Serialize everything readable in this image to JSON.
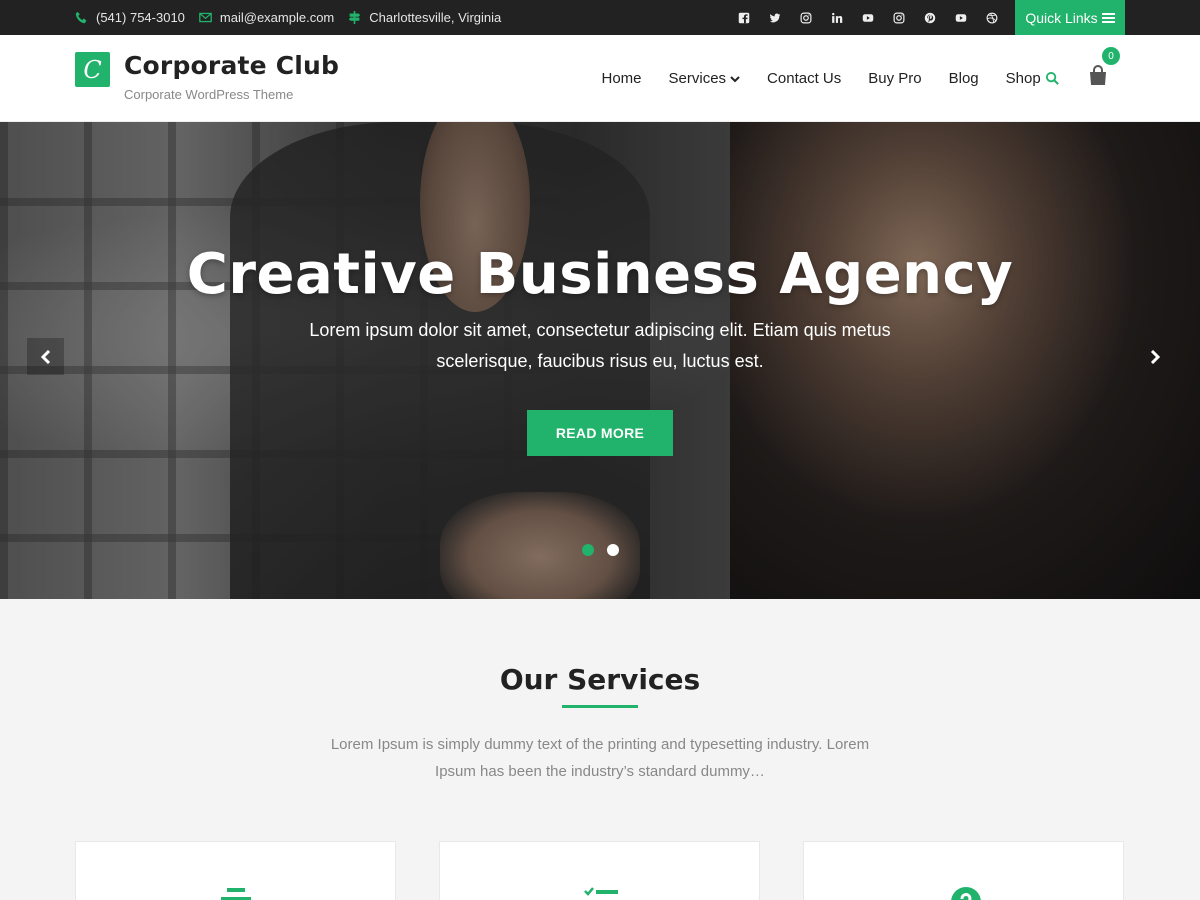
{
  "topbar": {
    "phone": "(541) 754-3010",
    "email": "mail@example.com",
    "location": "Charlottesville, Virginia",
    "social": [
      "facebook-icon",
      "twitter-icon",
      "instagram-icon",
      "linkedin-icon",
      "youtube-icon",
      "instagram-icon",
      "pinterest-icon",
      "youtube-icon",
      "dribbble-icon"
    ],
    "quick_links": "Quick Links"
  },
  "header": {
    "logo_letter": "C",
    "site_title": "Corporate Club",
    "site_description": "Corporate WordPress Theme",
    "cart_count": "0"
  },
  "nav": {
    "items": [
      {
        "label": "Home"
      },
      {
        "label": "Services"
      },
      {
        "label": "Contact Us"
      },
      {
        "label": "Buy Pro"
      },
      {
        "label": "Blog"
      },
      {
        "label": "Shop"
      }
    ]
  },
  "hero": {
    "title": "Creative Business Agency",
    "subtitle": "Lorem ipsum dolor sit amet, consectetur adipiscing elit. Etiam quis metus scelerisque, faucibus risus eu, luctus est.",
    "button": "READ MORE"
  },
  "services": {
    "title": "Our Services",
    "description": "Lorem Ipsum is simply dummy text of the printing and typesetting industry. Lorem Ipsum has been the industry’s standard dummy…"
  },
  "colors": {
    "accent": "#21b36b",
    "topbar_bg": "#222222"
  }
}
